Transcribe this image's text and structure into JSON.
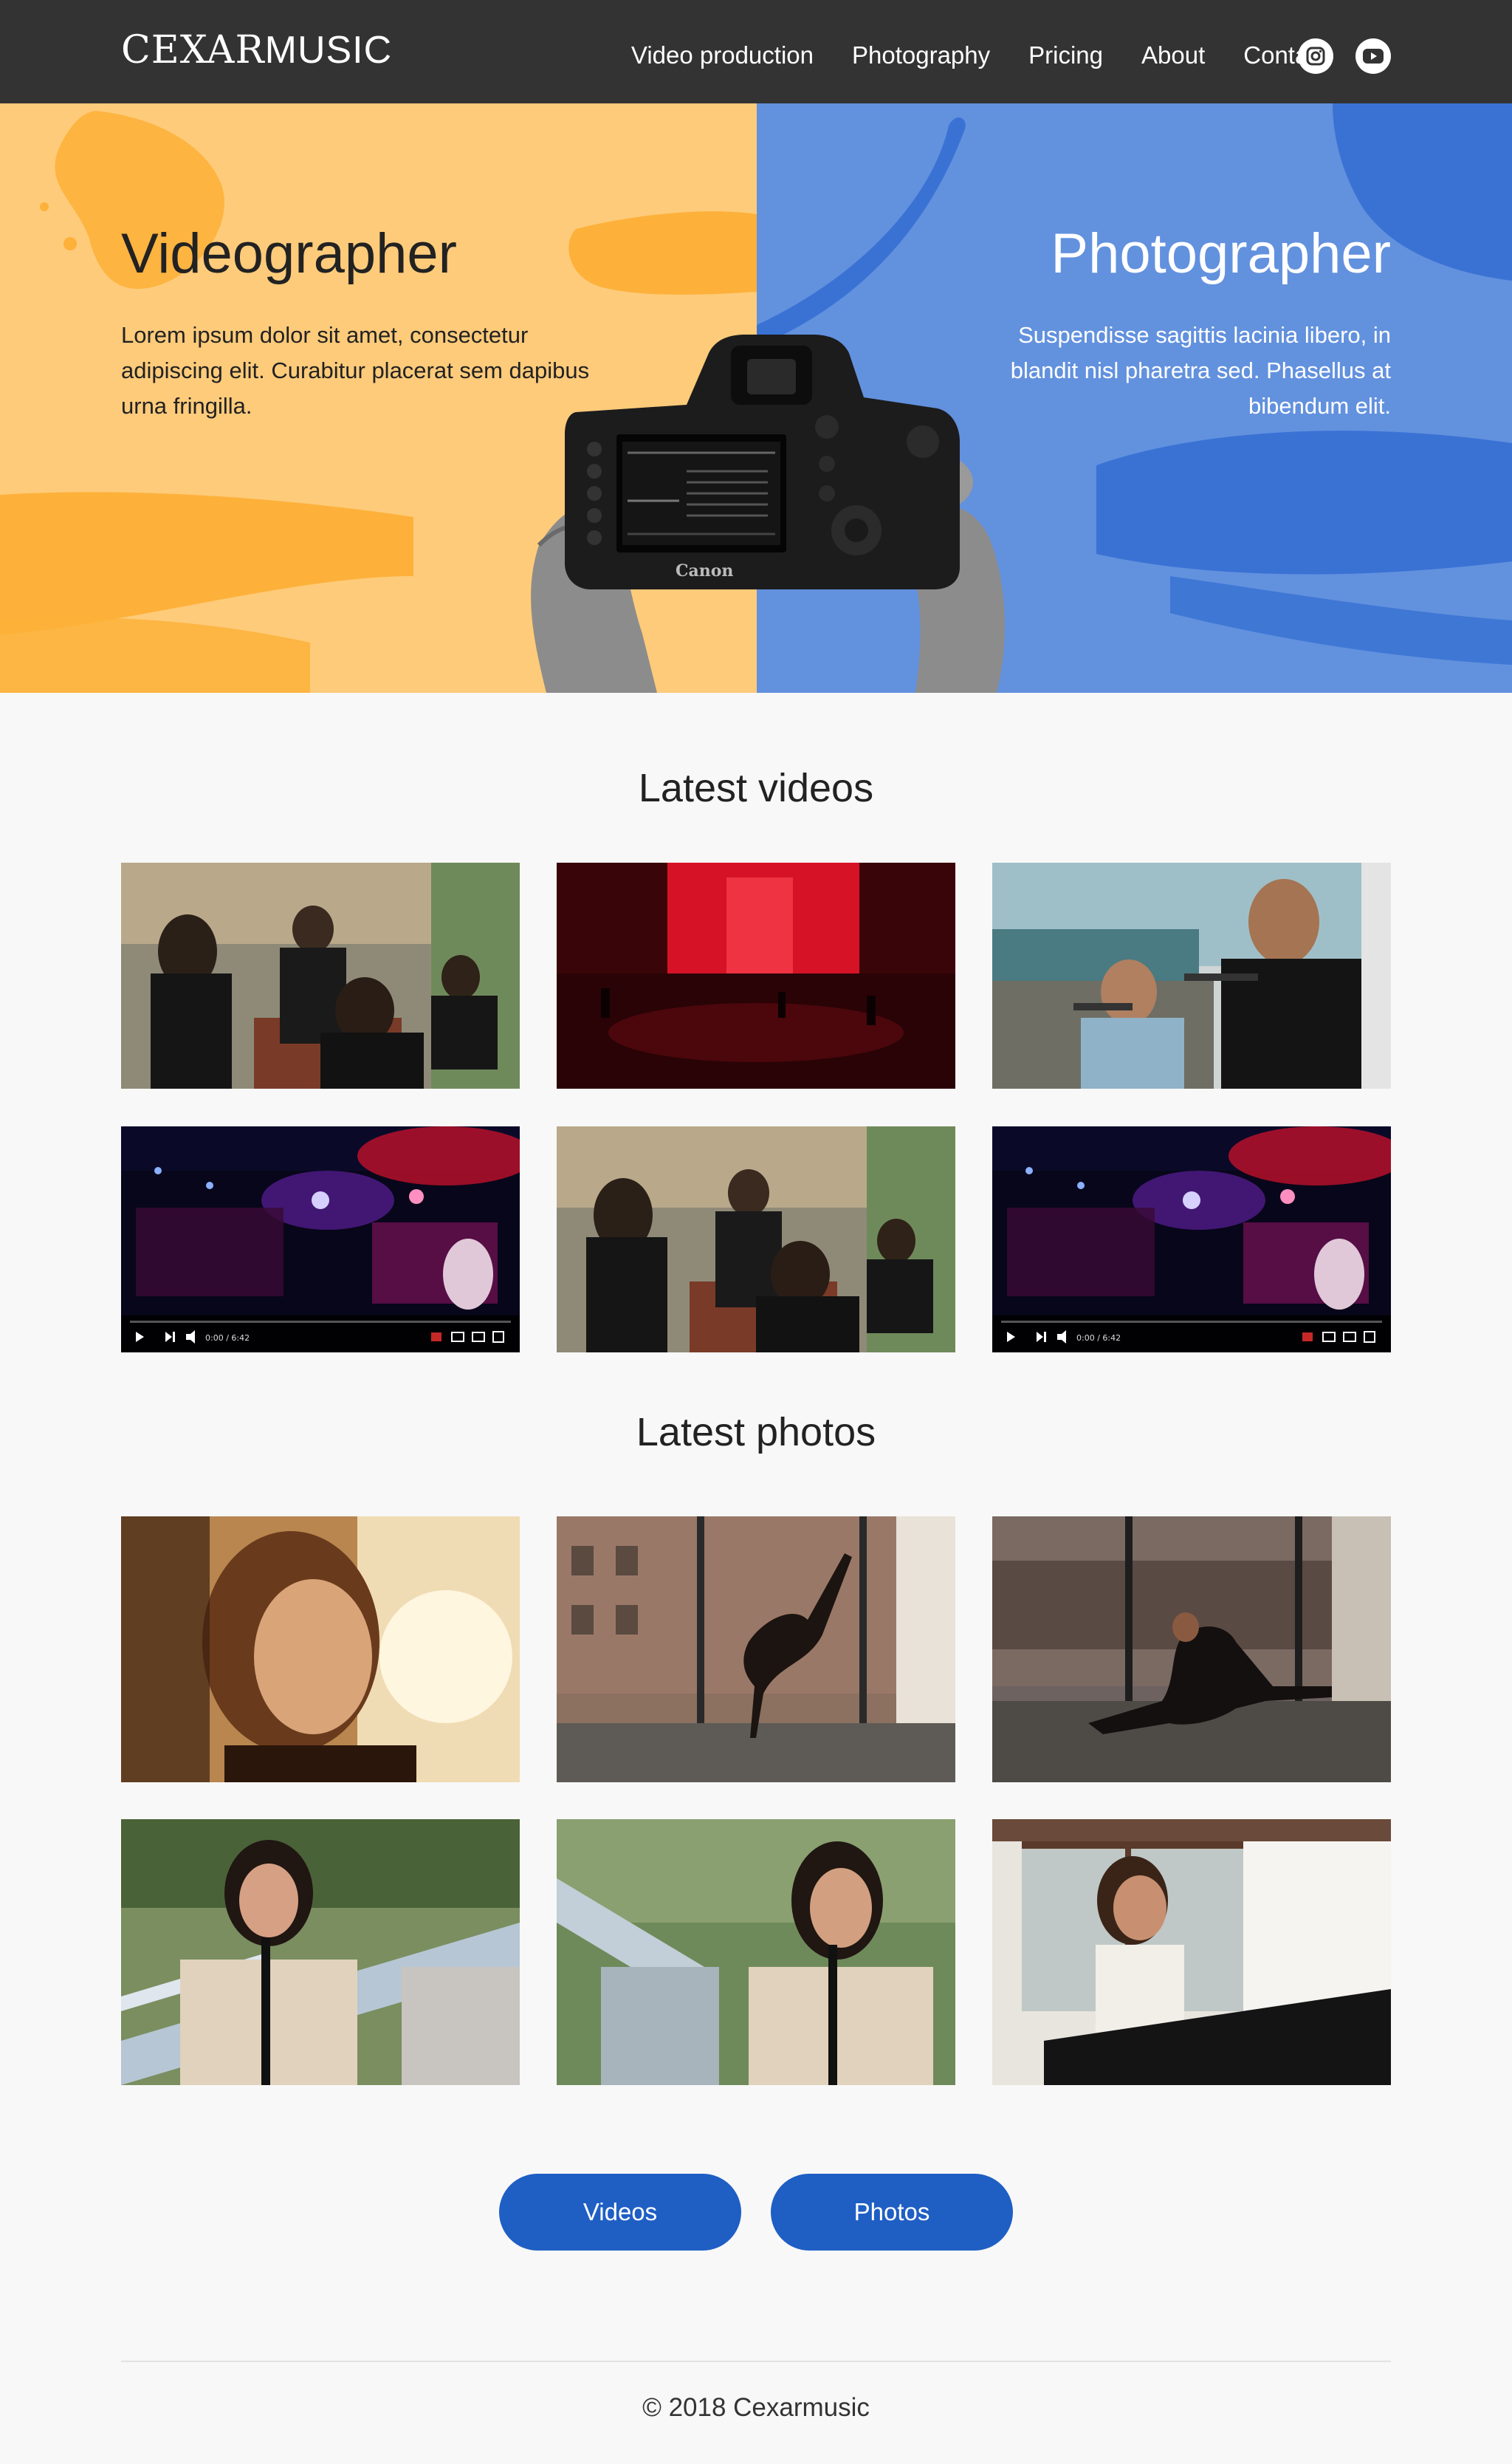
{
  "nav": {
    "logo_bold": "CEXAR",
    "logo_light": "MUSIC",
    "links": [
      "Video production",
      "Photography",
      "Pricing",
      "About",
      "Contact"
    ],
    "social_icons": [
      "instagram-icon",
      "youtube-icon"
    ]
  },
  "hero": {
    "left_title": "Videographer",
    "left_text": "Lorem ipsum dolor sit amet, consectetur adipiscing elit. Curabitur placerat sem dapibus urna fringilla.",
    "right_title": "Photographer",
    "right_text": "Suspendisse sagittis lacinia libero, in blandit nisl pharetra sed. Phasellus at bibendum elit.",
    "camera_brand": "Canon",
    "colors": {
      "left": "#fecb7a",
      "right": "#6291de",
      "left_brush": "#fdb13a",
      "right_brush": "#3a72d4"
    }
  },
  "videos": {
    "title": "Latest videos",
    "player_time": "0:00 / 6:42"
  },
  "photos": {
    "title": "Latest photos"
  },
  "buttons": {
    "videos": "Videos",
    "photos": "Photos"
  },
  "footer": {
    "copyright": "© 2018 Cexarmusic"
  },
  "colors": {
    "nav_bg": "#333333",
    "button": "#1f5fc4",
    "page_bg": "#f8f8f8"
  }
}
